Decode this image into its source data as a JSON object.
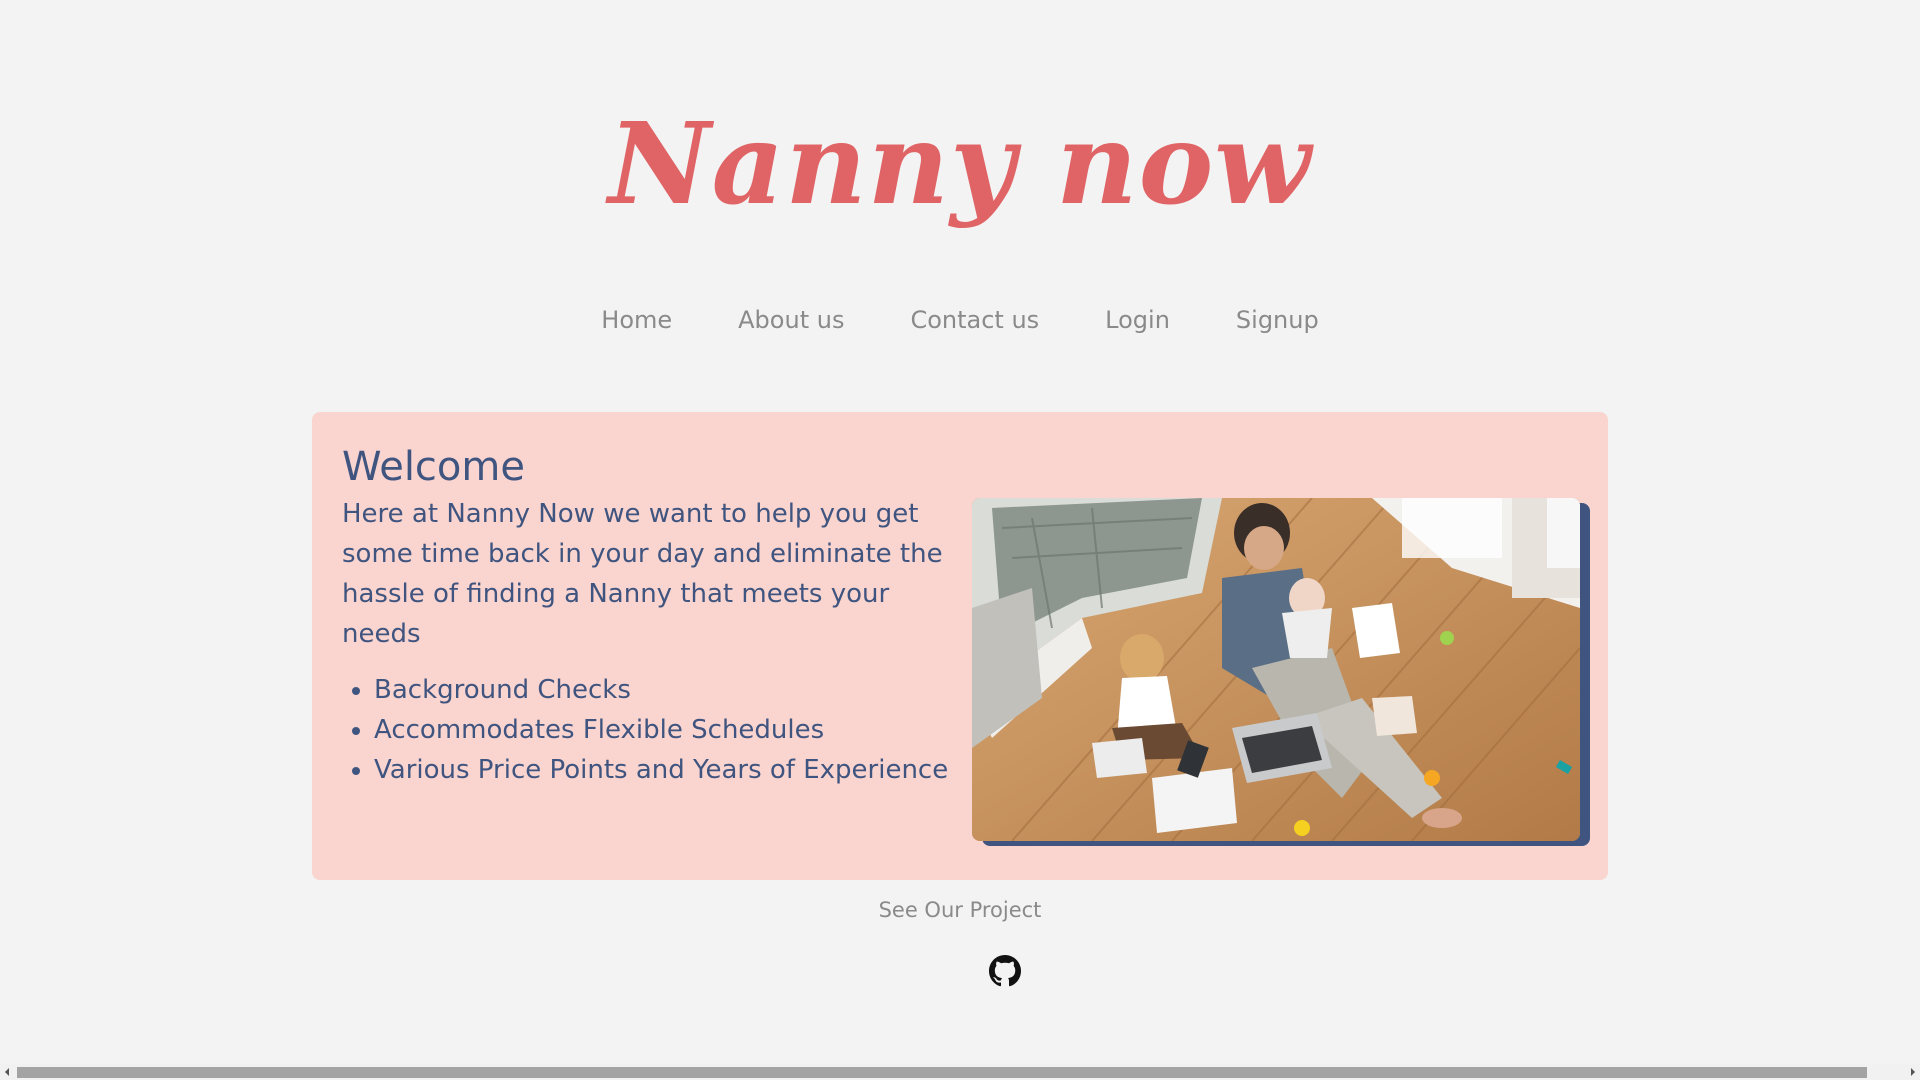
{
  "logo": {
    "text": "Nanny now"
  },
  "nav": {
    "items": [
      {
        "label": "Home"
      },
      {
        "label": "About us"
      },
      {
        "label": "Contact us"
      },
      {
        "label": "Login"
      },
      {
        "label": "Signup"
      }
    ]
  },
  "welcome": {
    "title": "Welcome",
    "text": "Here at Nanny Now we want to help you get some time back in your day and eliminate the hassle of finding a Nanny that meets your needs",
    "features": [
      {
        "label": "Background Checks"
      },
      {
        "label": "Accommodates Flexible Schedules"
      },
      {
        "label": "Various Price Points and Years of Experience"
      }
    ],
    "image": {
      "icon": "family-photo"
    }
  },
  "footer": {
    "see_project": "See Our Project",
    "icon": "github-icon"
  },
  "colors": {
    "brand": "#e06466",
    "accent": "#3f5580",
    "card": "#fad4cf",
    "background": "#f3f3f3"
  }
}
